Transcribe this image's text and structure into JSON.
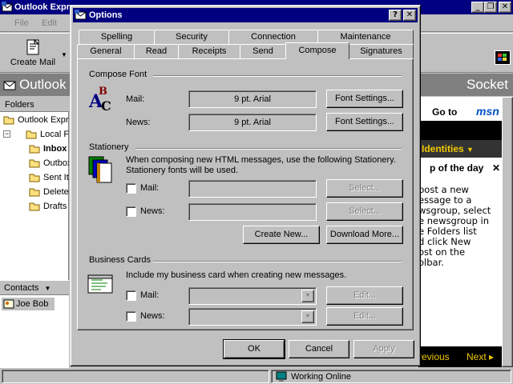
{
  "outlook": {
    "title": "Outlook Express",
    "menu": [
      "File",
      "Edit"
    ],
    "toolbar": {
      "create_mail": "Create Mail"
    },
    "band_left": "Outlook",
    "band_right": "Socket",
    "folders_label": "Folders",
    "tree": [
      {
        "label": "Outlook Express",
        "bold": false,
        "indent": 0
      },
      {
        "label": "Local Folders",
        "bold": false,
        "indent": 1
      },
      {
        "label": "Inbox",
        "bold": true,
        "indent": 2
      },
      {
        "label": "Outbox",
        "bold": false,
        "indent": 2
      },
      {
        "label": "Sent Items",
        "bold": false,
        "indent": 2
      },
      {
        "label": "Deleted Items",
        "bold": false,
        "indent": 2
      },
      {
        "label": "Drafts",
        "bold": false,
        "indent": 2
      }
    ],
    "contacts_label": "Contacts",
    "contact_name": "Joe Bob",
    "goto": "Go to",
    "msn": "msn",
    "identities": "Identities",
    "tip_title": "p of the day",
    "tip_lines": [
      "post a new",
      "essage to a",
      "wsgroup, select",
      "e newsgroup in",
      "e Folders list",
      "d click New",
      "ost on the",
      "olbar."
    ],
    "previous": "revious",
    "next": "Next",
    "status_online": "Working Online"
  },
  "dialog": {
    "title": "Options",
    "tabs_row1": [
      "Spelling",
      "Security",
      "Connection",
      "Maintenance"
    ],
    "tabs_row2": [
      "General",
      "Read",
      "Receipts",
      "Send",
      "Compose",
      "Signatures"
    ],
    "active_tab": "Compose",
    "compose_font": {
      "heading": "Compose Font",
      "mail_label": "Mail:",
      "mail_value": "9 pt. Arial",
      "news_label": "News:",
      "news_value": "9 pt. Arial",
      "font_settings": "Font Settings..."
    },
    "stationery": {
      "heading": "Stationery",
      "description": "When composing new HTML messages, use the following Stationery. Stationery fonts will be used.",
      "mail_label": "Mail:",
      "news_label": "News:",
      "select": "Select...",
      "create_new": "Create New...",
      "download_more": "Download More..."
    },
    "business_cards": {
      "heading": "Business Cards",
      "description": "Include my business card when creating new messages.",
      "mail_label": "Mail:",
      "news_label": "News:",
      "edit": "Edit..."
    },
    "buttons": {
      "ok": "OK",
      "cancel": "Cancel",
      "apply": "Apply"
    }
  },
  "colors": {
    "titlebar": "#000080",
    "face": "#c0c0c0",
    "accent_msn": "#0050c8",
    "accent_yellow": "#f0c800"
  }
}
